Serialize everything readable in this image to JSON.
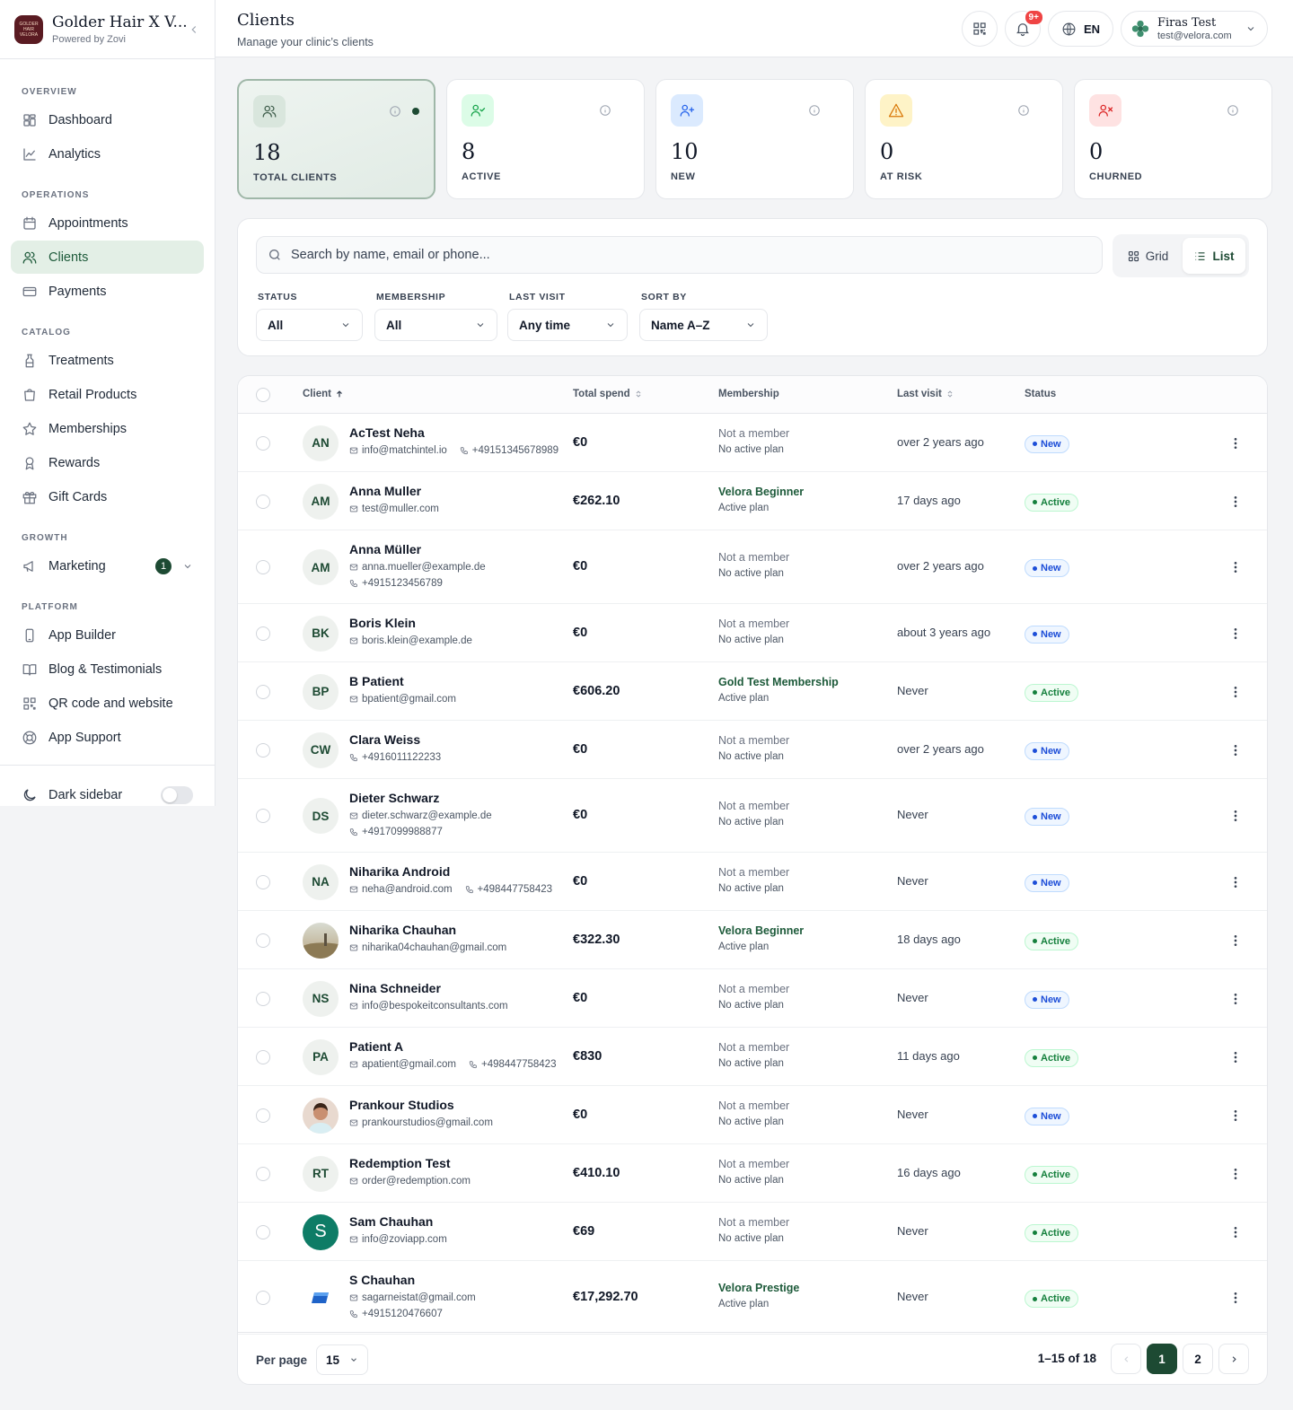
{
  "brand": {
    "name": "Golder Hair X V...",
    "powered": "Powered by Zovi",
    "logo_text": "GOLDER HAIR VELORA"
  },
  "sidebar": {
    "sections": [
      {
        "title": "OVERVIEW",
        "items": [
          {
            "label": "Dashboard",
            "icon": "dashboard-icon"
          },
          {
            "label": "Analytics",
            "icon": "analytics-icon"
          }
        ]
      },
      {
        "title": "OPERATIONS",
        "items": [
          {
            "label": "Appointments",
            "icon": "calendar-icon"
          },
          {
            "label": "Clients",
            "icon": "users-icon",
            "active": true
          },
          {
            "label": "Payments",
            "icon": "card-icon"
          }
        ]
      },
      {
        "title": "CATALOG",
        "items": [
          {
            "label": "Treatments",
            "icon": "treatment-icon"
          },
          {
            "label": "Retail Products",
            "icon": "bag-icon"
          },
          {
            "label": "Memberships",
            "icon": "star-icon"
          },
          {
            "label": "Rewards",
            "icon": "award-icon"
          },
          {
            "label": "Gift Cards",
            "icon": "gift-icon"
          }
        ]
      },
      {
        "title": "GROWTH",
        "items": [
          {
            "label": "Marketing",
            "icon": "megaphone-icon",
            "badge": "1",
            "expand": true
          }
        ]
      },
      {
        "title": "PLATFORM",
        "items": [
          {
            "label": "App Builder",
            "icon": "phone-icon"
          },
          {
            "label": "Blog & Testimonials",
            "icon": "book-icon"
          },
          {
            "label": "QR code and website",
            "icon": "qr-icon"
          },
          {
            "label": "App Support",
            "icon": "lifebuoy-icon"
          }
        ]
      }
    ],
    "dark_sidebar_label": "Dark sidebar"
  },
  "header": {
    "title": "Clients",
    "subtitle": "Manage your clinic’s clients",
    "notif_badge": "9+",
    "lang": "EN",
    "user_name": "Firas Test",
    "user_email": "test@velora.com"
  },
  "stats": [
    {
      "value": "18",
      "label": "TOTAL CLIENTS",
      "icon": "users-icon",
      "color": "#3f5e4c",
      "bg": "#d9e6dd",
      "selected": true
    },
    {
      "value": "8",
      "label": "ACTIVE",
      "icon": "user-check-icon",
      "color": "#16a34a",
      "bg": "#dcfce7"
    },
    {
      "value": "10",
      "label": "NEW",
      "icon": "user-plus-icon",
      "color": "#2563eb",
      "bg": "#dbeafe"
    },
    {
      "value": "0",
      "label": "AT RISK",
      "icon": "warning-icon",
      "color": "#d97706",
      "bg": "#fef3c7"
    },
    {
      "value": "0",
      "label": "CHURNED",
      "icon": "user-x-icon",
      "color": "#dc2626",
      "bg": "#fee2e2"
    }
  ],
  "filters": {
    "search_placeholder": "Search by name, email or phone...",
    "view_grid": "Grid",
    "view_list": "List",
    "status_label": "STATUS",
    "status_value": "All",
    "membership_label": "MEMBERSHIP",
    "membership_value": "All",
    "lastvisit_label": "LAST VISIT",
    "lastvisit_value": "Any time",
    "sort_label": "SORT BY",
    "sort_value": "Name A–Z"
  },
  "table": {
    "headers": {
      "client": "Client",
      "spend": "Total spend",
      "membership": "Membership",
      "last_visit": "Last visit",
      "status": "Status"
    },
    "rows": [
      {
        "initials": "AN",
        "name": "AcTest Neha",
        "email": "info@matchintel.io",
        "phone": "+49151345678989",
        "inline": true,
        "spend": "€0",
        "mem": "Not a member",
        "plan": "No active plan",
        "last": "over 2 years ago",
        "status": "New"
      },
      {
        "initials": "AM",
        "name": "Anna Muller",
        "email": "test@muller.com",
        "spend": "€262.10",
        "mem": "Velora Beginner",
        "plan": "Active plan",
        "member": true,
        "last": "17 days ago",
        "status": "Active"
      },
      {
        "initials": "AM",
        "name": "Anna Müller",
        "email": "anna.mueller@example.de",
        "phone": "+4915123456789",
        "spend": "€0",
        "mem": "Not a member",
        "plan": "No active plan",
        "last": "over 2 years ago",
        "status": "New"
      },
      {
        "initials": "BK",
        "name": "Boris Klein",
        "email": "boris.klein@example.de",
        "spend": "€0",
        "mem": "Not a member",
        "plan": "No active plan",
        "last": "about 3 years ago",
        "status": "New"
      },
      {
        "initials": "BP",
        "name": "B Patient",
        "email": "bpatient@gmail.com",
        "spend": "€606.20",
        "mem": "Gold Test Membership",
        "plan": "Active plan",
        "member": true,
        "last": "Never",
        "status": "Active"
      },
      {
        "initials": "CW",
        "name": "Clara Weiss",
        "phone": "+4916011122233",
        "spend": "€0",
        "mem": "Not a member",
        "plan": "No active plan",
        "last": "over 2 years ago",
        "status": "New"
      },
      {
        "initials": "DS",
        "name": "Dieter Schwarz",
        "email": "dieter.schwarz@example.de",
        "phone": "+4917099988877",
        "spend": "€0",
        "mem": "Not a member",
        "plan": "No active plan",
        "last": "Never",
        "status": "New"
      },
      {
        "initials": "NA",
        "name": "Niharika Android",
        "email": "neha@android.com",
        "phone": "+498447758423",
        "inline": true,
        "spend": "€0",
        "mem": "Not a member",
        "plan": "No active plan",
        "last": "Never",
        "status": "New"
      },
      {
        "photo": "landscape",
        "name": "Niharika Chauhan",
        "email": "niharika04chauhan@gmail.com",
        "spend": "€322.30",
        "mem": "Velora Beginner",
        "plan": "Active plan",
        "member": true,
        "last": "18 days ago",
        "status": "Active"
      },
      {
        "initials": "NS",
        "name": "Nina Schneider",
        "email": "info@bespokeitconsultants.com",
        "spend": "€0",
        "mem": "Not a member",
        "plan": "No active plan",
        "last": "Never",
        "status": "New"
      },
      {
        "initials": "PA",
        "name": "Patient A",
        "email": "apatient@gmail.com",
        "phone": "+498447758423",
        "inline": true,
        "spend": "€830",
        "mem": "Not a member",
        "plan": "No active plan",
        "last": "11 days ago",
        "status": "Active"
      },
      {
        "photo": "person",
        "name": "Prankour Studios",
        "email": "prankourstudios@gmail.com",
        "spend": "€0",
        "mem": "Not a member",
        "plan": "No active plan",
        "last": "Never",
        "status": "New"
      },
      {
        "initials": "RT",
        "name": "Redemption Test",
        "email": "order@redemption.com",
        "spend": "€410.10",
        "mem": "Not a member",
        "plan": "No active plan",
        "last": "16 days ago",
        "status": "Active"
      },
      {
        "letter": "S",
        "name": "Sam Chauhan",
        "email": "info@zoviapp.com",
        "spend": "€69",
        "mem": "Not a member",
        "plan": "No active plan",
        "last": "Never",
        "status": "Active"
      },
      {
        "photo": "logo",
        "name": "S Chauhan",
        "email": "sagarneistat@gmail.com",
        "phone": "+4915120476607",
        "spend": "€17,292.70",
        "mem": "Velora Prestige",
        "plan": "Active plan",
        "member": true,
        "last": "Never",
        "status": "Active"
      }
    ]
  },
  "pagination": {
    "per_page_label": "Per page",
    "per_page": "15",
    "range": "1–15 of 18",
    "pages": [
      "1",
      "2"
    ],
    "current": "1"
  }
}
